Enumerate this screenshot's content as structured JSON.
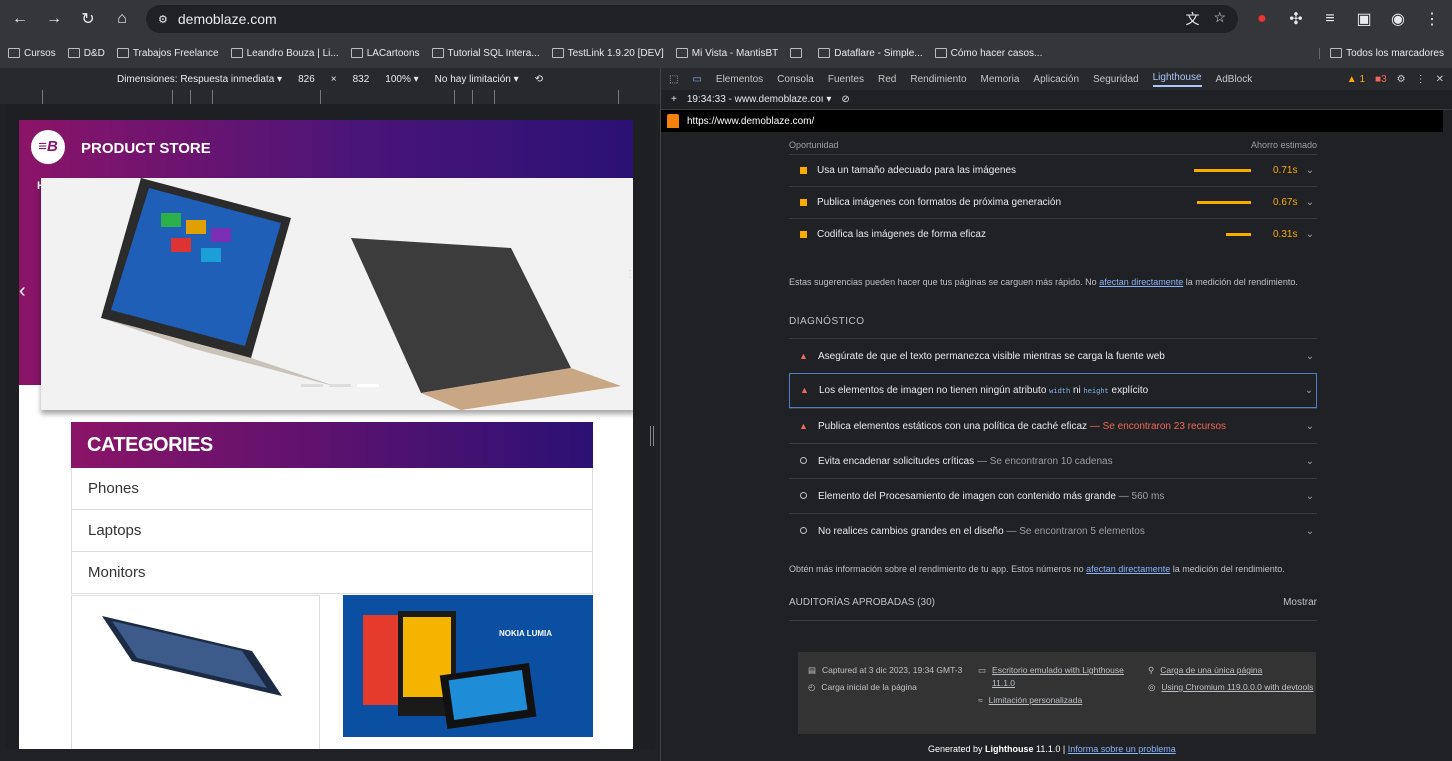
{
  "browser": {
    "url": "demoblaze.com"
  },
  "bookmarks": [
    "Cursos",
    "D&D",
    "Trabajos Freelance",
    "Leandro Bouza | Li...",
    "LACartoons",
    "Tutorial SQL Intera...",
    "TestLink 1.9.20 [DEV]",
    "Mi Vista - MantisBT",
    "",
    "Dataflare - Simple...",
    "Cómo hacer casos..."
  ],
  "bookmarks_right": "Todos los marcadores",
  "device_toolbar": {
    "dimensions": "Dimensiones: Respuesta inmediata ▾",
    "width": "826",
    "x": "×",
    "height": "832",
    "zoom": "100% ▾",
    "throttle": "No hay limitación ▾"
  },
  "site": {
    "store": "PRODUCT STORE",
    "home_initial": "H",
    "categories_title": "CATEGORIES",
    "categories": [
      "Phones",
      "Laptops",
      "Monitors"
    ],
    "nokia": "NOKIA LUMIA",
    "logo": "≡B"
  },
  "devtools": {
    "tabs": [
      "Elementos",
      "Consola",
      "Fuentes",
      "Red",
      "Rendimiento",
      "Memoria",
      "Aplicación",
      "Seguridad",
      "Lighthouse",
      "AdBlock"
    ],
    "warn_count": "1",
    "err_count": "3",
    "session": "19:34:33 - www.demoblaze.coı ▾",
    "report_url": "https://www.demoblaze.com/"
  },
  "report": {
    "col_left": "Oportunidad",
    "col_right": "Ahorro estimado",
    "opportunities": [
      {
        "label": "Usa un tamaño adecuado para las imágenes",
        "value": "0.71s",
        "fraction": 0.71
      },
      {
        "label": "Publica imágenes con formatos de próxima generación",
        "value": "0.67s",
        "fraction": 0.67
      },
      {
        "label": "Codifica las imágenes de forma eficaz",
        "value": "0.31s",
        "fraction": 0.31
      }
    ],
    "note1_a": "Estas sugerencias pueden hacer que tus páginas se carguen más rápido. No ",
    "note1_link": "afectan directamente",
    "note1_b": " la medición del rendimiento.",
    "diag_title": "DIAGNÓSTICO",
    "diag": [
      {
        "label": "Asegúrate de que el texto permanezca visible mientras se carga la fuente web",
        "detail": "",
        "kind": "fail"
      },
      {
        "label": "Los elementos de imagen no tienen ningún atributo ",
        "code1": "width",
        "mid": " ni ",
        "code2": "height",
        "end": " explícito",
        "kind": "fail"
      },
      {
        "label": "Publica elementos estáticos con una política de caché eficaz",
        "detail": " — Se encontraron 23 recursos",
        "kind": "fail"
      },
      {
        "label": "Evita encadenar solicitudes críticas",
        "detail": " — Se encontraron 10 cadenas",
        "kind": "info"
      },
      {
        "label": "Elemento del Procesamiento de imagen con contenido más grande",
        "detail": " — 560 ms",
        "kind": "info"
      },
      {
        "label": "No realices cambios grandes en el diseño",
        "detail": " — Se encontraron 5 elementos",
        "kind": "info"
      }
    ],
    "note2_a": "Obtén más información sobre el rendimiento de tu app. Estos números no ",
    "note2_link": "afectan directamente",
    "note2_b": " la medición del rendimiento.",
    "passed": "AUDITORÍAS APROBADAS (30)",
    "show": "Mostrar",
    "footer": {
      "captured": "Captured at 3 dic 2023, 19:34 GMT-3",
      "initial": "Carga inicial de la página",
      "emulated": "Escritorio emulado with Lighthouse 11.1.0",
      "throttling": "Limitación personalizada",
      "single": "Carga de una única página",
      "chromium": "Using Chromium 119.0.0.0 with devtools"
    },
    "gen_a": "Generated by ",
    "gen_b": "Lighthouse",
    "gen_c": " 11.1.0 | ",
    "gen_link": "Informa sobre un problema"
  }
}
